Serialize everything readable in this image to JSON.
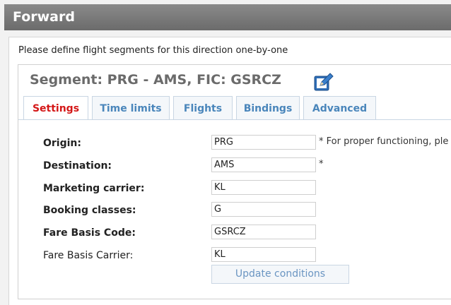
{
  "header": {
    "title": "Forward"
  },
  "panel": {
    "intro": "Please define flight segments for this direction one-by-one"
  },
  "segment": {
    "title": "Segment: PRG - AMS, FIC: GSRCZ",
    "edit_icon": "edit-icon"
  },
  "tabs": [
    {
      "label": "Settings",
      "active": true
    },
    {
      "label": "Time limits",
      "active": false
    },
    {
      "label": "Flights",
      "active": false
    },
    {
      "label": "Bindings",
      "active": false
    },
    {
      "label": "Advanced",
      "active": false
    }
  ],
  "form": {
    "origin": {
      "label": "Origin:",
      "value": "PRG",
      "hint": "* For proper functioning, ple"
    },
    "destination": {
      "label": "Destination:",
      "value": "AMS",
      "hint": "*"
    },
    "marketing_carrier": {
      "label": "Marketing carrier:",
      "value": "KL"
    },
    "booking_classes": {
      "label": "Booking classes:",
      "value": "G"
    },
    "fare_basis_code": {
      "label": "Fare Basis Code:",
      "value": "GSRCZ"
    },
    "fare_basis_carrier": {
      "label": "Fare Basis Carrier:",
      "value": "KL"
    },
    "update_button": "Update conditions"
  },
  "colors": {
    "active_tab": "#d41717",
    "tab_text": "#4a86bb",
    "header_bg": "#777777"
  }
}
